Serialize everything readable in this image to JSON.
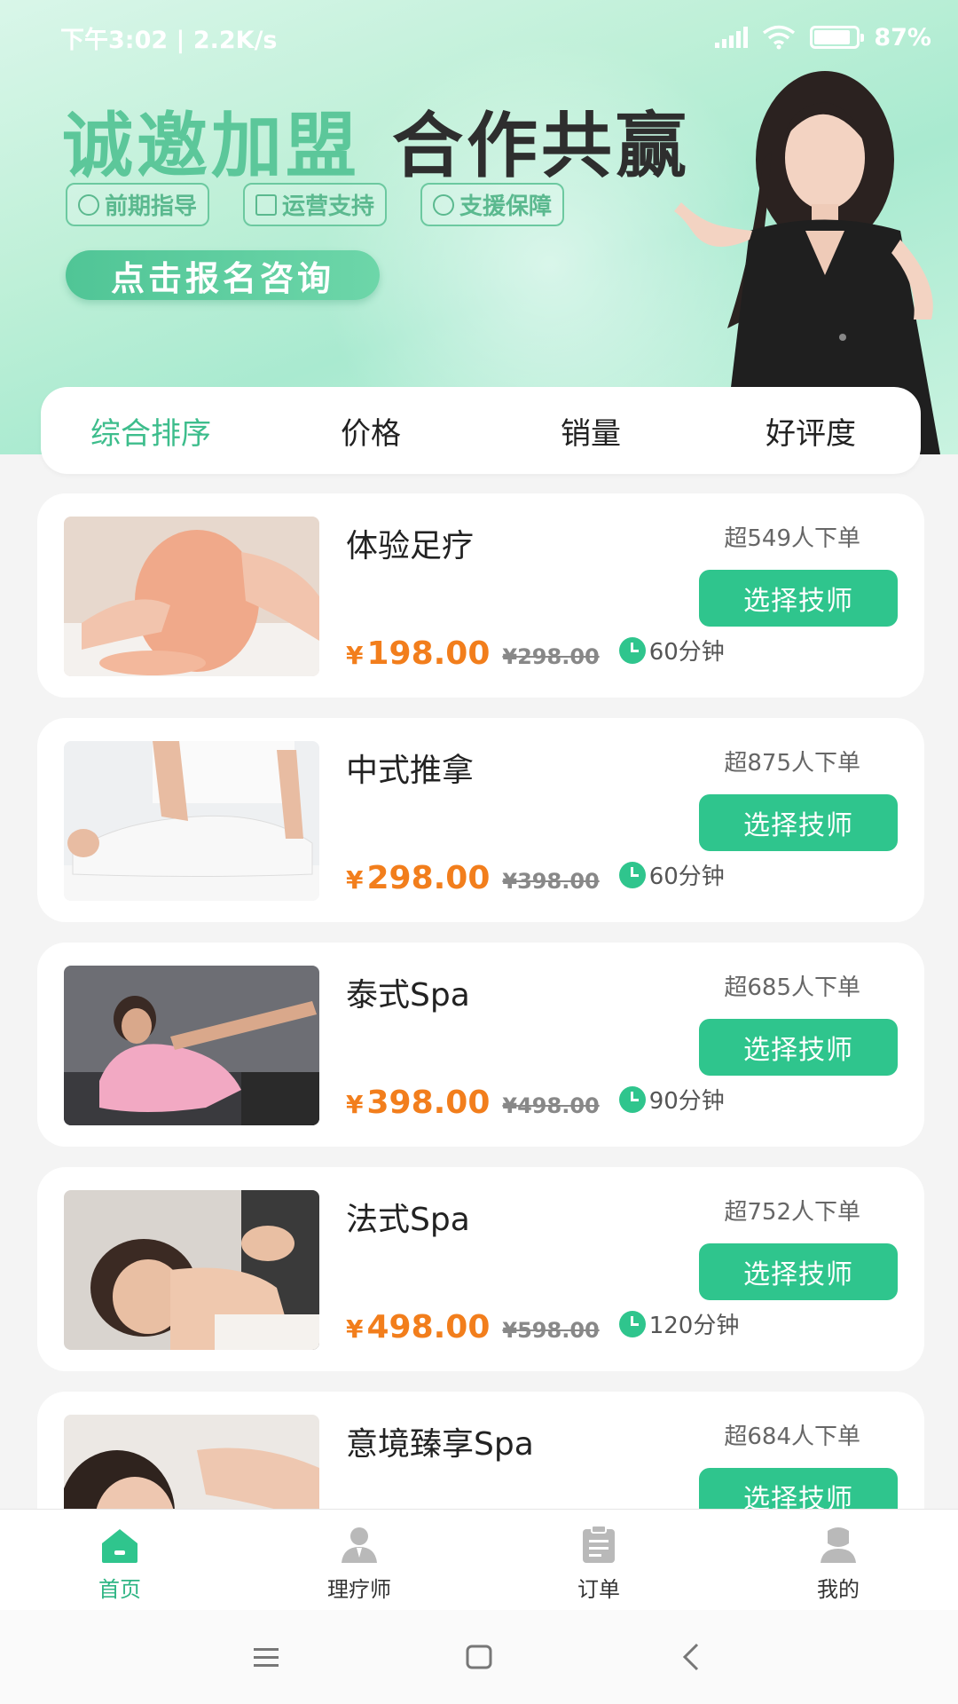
{
  "status_bar": {
    "time_speed": "下午3:02 | 2.2K/s",
    "battery": "87%"
  },
  "banner": {
    "headline_green": "诚邀加盟",
    "headline_dark": "合作共赢",
    "tags": [
      "前期指导",
      "运营支持",
      "支援保障"
    ],
    "cta_label": "点击报名咨询"
  },
  "sort_tabs": [
    "综合排序",
    "价格",
    "销量",
    "好评度"
  ],
  "services": [
    {
      "name": "体验足疗",
      "sold": "超549人下单",
      "button": "选择技师",
      "currency": "¥",
      "price": "198.00",
      "original": "¥298.00",
      "duration": "60分钟"
    },
    {
      "name": "中式推拿",
      "sold": "超875人下单",
      "button": "选择技师",
      "currency": "¥",
      "price": "298.00",
      "original": "¥398.00",
      "duration": "60分钟"
    },
    {
      "name": "泰式Spa",
      "sold": "超685人下单",
      "button": "选择技师",
      "currency": "¥",
      "price": "398.00",
      "original": "¥498.00",
      "duration": "90分钟"
    },
    {
      "name": "法式Spa",
      "sold": "超752人下单",
      "button": "选择技师",
      "currency": "¥",
      "price": "498.00",
      "original": "¥598.00",
      "duration": "120分钟"
    },
    {
      "name": "意境臻享Spa",
      "sold": "超684人下单",
      "button": "选择技师",
      "currency": "¥",
      "price": "",
      "original": "",
      "duration": ""
    }
  ],
  "tabbar": [
    {
      "label": "首页",
      "icon": "home-icon",
      "active": true
    },
    {
      "label": "理疗师",
      "icon": "therapist-icon",
      "active": false
    },
    {
      "label": "订单",
      "icon": "order-icon",
      "active": false
    },
    {
      "label": "我的",
      "icon": "profile-icon",
      "active": false
    }
  ],
  "colors": {
    "accent": "#2fc58d",
    "price": "#f27e1c",
    "active_sort": "#3dbd8c"
  }
}
